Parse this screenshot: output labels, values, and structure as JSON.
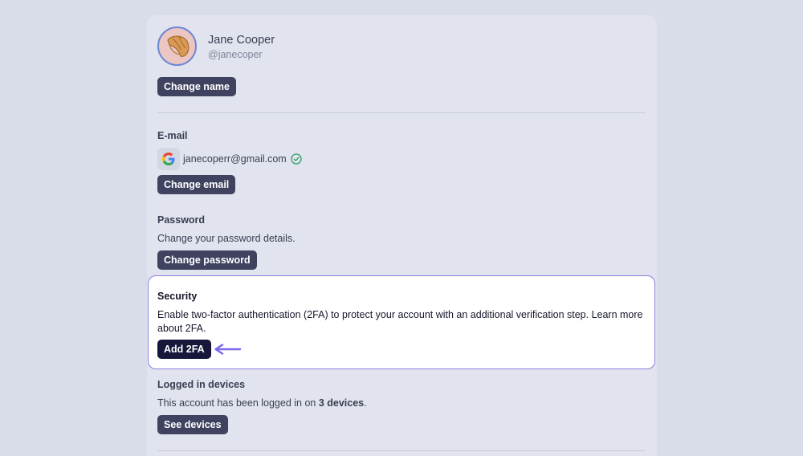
{
  "profile": {
    "name": "Jane Cooper",
    "handle": "@janecoper",
    "change_name_label": "Change name"
  },
  "email": {
    "heading": "E-mail",
    "address": "janecoperr@gmail.com",
    "change_label": "Change email",
    "provider_icon": "google-icon",
    "status_icon": "verified-check-icon"
  },
  "password": {
    "heading": "Password",
    "description": "Change your password details.",
    "change_label": "Change password"
  },
  "security": {
    "heading": "Security",
    "description": "Enable two-factor authentication (2FA) to protect your account with an additional verification step. Learn more about 2FA.",
    "add_label": "Add 2FA",
    "highlight_color": "#8b7ee0",
    "pointer_icon": "arrow-left-icon"
  },
  "devices": {
    "heading": "Logged in devices",
    "description_prefix": "This account has been logged in on ",
    "count_text": "3 devices",
    "description_suffix": ".",
    "see_label": "See devices"
  }
}
